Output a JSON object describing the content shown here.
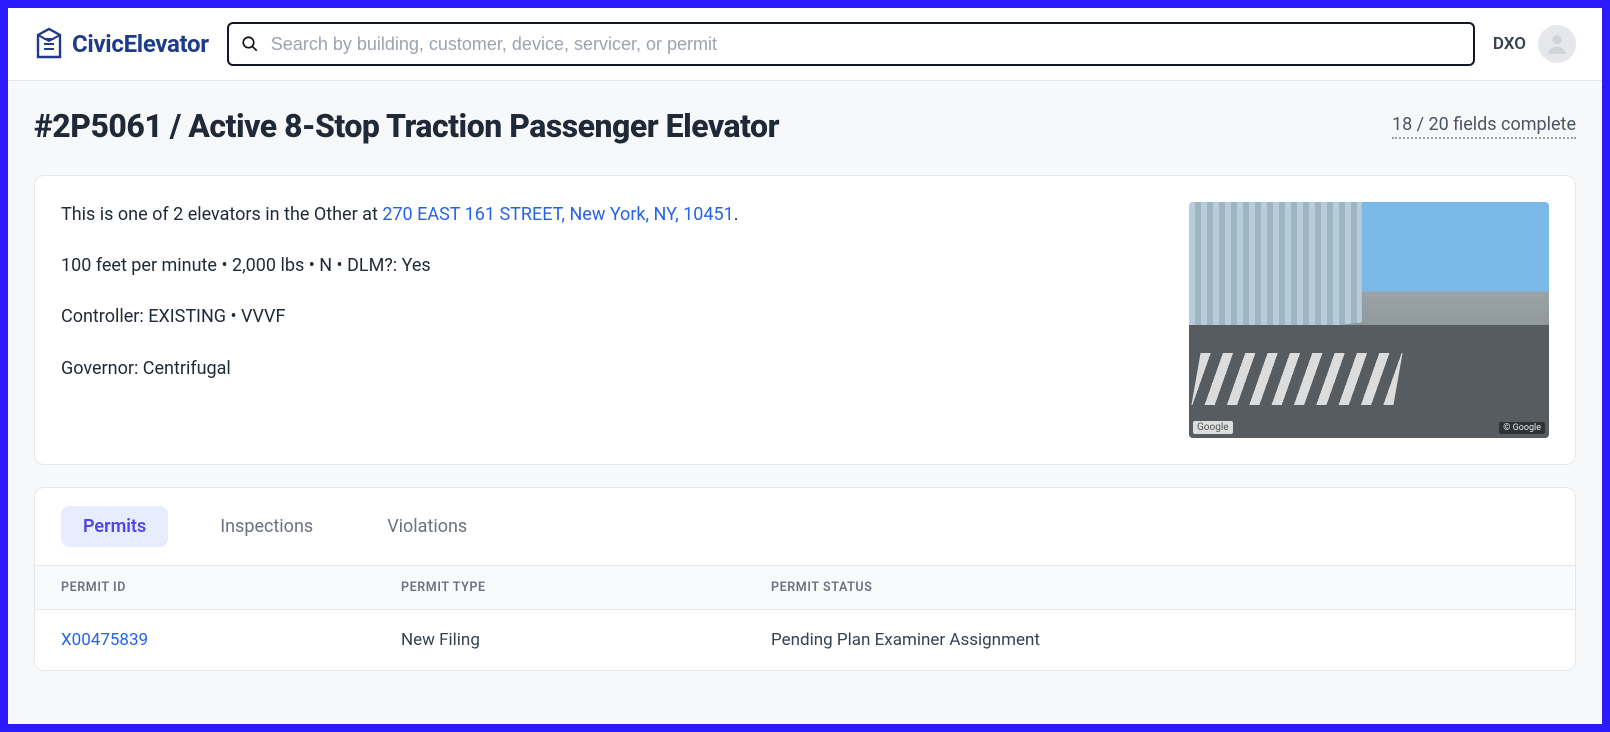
{
  "brand": {
    "name": "CivicElevator"
  },
  "search": {
    "placeholder": "Search by building, customer, device, servicer, or permit"
  },
  "user": {
    "initials": "DXO"
  },
  "page": {
    "title": "#2P5061 / Active 8-Stop Traction Passenger Elevator",
    "fields_complete": "18 / 20 fields complete"
  },
  "summary": {
    "intro_prefix": "This is one of 2 elevators in the Other at ",
    "address_link": "270 EAST 161 STREET, New York, NY, 10451",
    "intro_suffix": ".",
    "specs": "100 feet per minute • 2,000 lbs • N • DLM?: Yes",
    "controller": "Controller: EXISTING • VVVF",
    "governor": "Governor: Centrifugal",
    "streetview": {
      "provider": "Google",
      "copyright": "© Google"
    }
  },
  "tabs": {
    "items": [
      {
        "label": "Permits",
        "active": true
      },
      {
        "label": "Inspections",
        "active": false
      },
      {
        "label": "Violations",
        "active": false
      }
    ]
  },
  "permits_table": {
    "columns": {
      "id": "PERMIT ID",
      "type": "PERMIT TYPE",
      "status": "PERMIT STATUS"
    },
    "rows": [
      {
        "id": "X00475839",
        "type": "New Filing",
        "status": "Pending Plan Examiner Assignment"
      }
    ]
  }
}
